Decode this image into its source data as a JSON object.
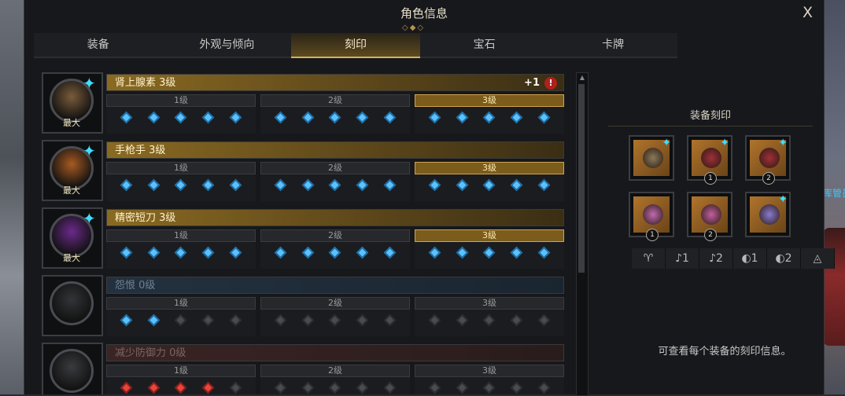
{
  "window": {
    "title": "角色信息",
    "close_label": "X"
  },
  "tabs": [
    {
      "label": "装备",
      "active": false
    },
    {
      "label": "外观与倾向",
      "active": false
    },
    {
      "label": "刻印",
      "active": true
    },
    {
      "label": "宝石",
      "active": false
    },
    {
      "label": "卡牌",
      "active": false
    }
  ],
  "level_labels": [
    "1级",
    "2级",
    "3级"
  ],
  "engravings": [
    {
      "name": "肾上腺素 3级",
      "style": "gold",
      "badge": "最大",
      "plus": "+1",
      "alert": "!",
      "active_level": 3,
      "gems": [
        "blue",
        "blue",
        "blue",
        "blue",
        "blue",
        "blue",
        "blue",
        "blue",
        "blue",
        "blue",
        "blue",
        "blue",
        "blue",
        "blue",
        "blue"
      ],
      "orb_color": "#7a5c3a"
    },
    {
      "name": "手枪手 3级",
      "style": "gold",
      "badge": "最大",
      "plus": "",
      "alert": "",
      "active_level": 3,
      "gems": [
        "blue",
        "blue",
        "blue",
        "blue",
        "blue",
        "blue",
        "blue",
        "blue",
        "blue",
        "blue",
        "blue",
        "blue",
        "blue",
        "blue",
        "blue"
      ],
      "orb_color": "#a85a22"
    },
    {
      "name": "精密短刀 3级",
      "style": "gold",
      "badge": "最大",
      "plus": "",
      "alert": "",
      "active_level": 3,
      "gems": [
        "blue",
        "blue",
        "blue",
        "blue",
        "blue",
        "blue",
        "blue",
        "blue",
        "blue",
        "blue",
        "blue",
        "blue",
        "blue",
        "blue",
        "blue"
      ],
      "orb_color": "#6a2a8a"
    },
    {
      "name": "怨恨 0级",
      "style": "blue",
      "badge": "",
      "plus": "",
      "alert": "",
      "active_level": 0,
      "gems": [
        "blue",
        "blue",
        "off",
        "off",
        "off",
        "off",
        "off",
        "off",
        "off",
        "off",
        "off",
        "off",
        "off",
        "off",
        "off"
      ],
      "orb_color": "#333438"
    },
    {
      "name": "减少防御力 0级",
      "style": "red",
      "badge": "",
      "plus": "",
      "alert": "",
      "active_level": 0,
      "gems": [
        "red",
        "red",
        "red",
        "red",
        "off",
        "off",
        "off",
        "off",
        "off",
        "off",
        "off",
        "off",
        "off",
        "off",
        "off"
      ],
      "orb_color": "#3a3b3f"
    }
  ],
  "side_panel": {
    "title": "装备刻印",
    "slots": [
      {
        "item": "necklace-icon",
        "number": "",
        "has_spark": true,
        "color": "#8a7a5a"
      },
      {
        "item": "earring-icon",
        "number": "1",
        "has_spark": true,
        "color": "#a0303a"
      },
      {
        "item": "earring-icon",
        "number": "2",
        "has_spark": true,
        "color": "#a0303a"
      },
      {
        "item": "ring-icon",
        "number": "1",
        "has_spark": false,
        "color": "#c06ab0"
      },
      {
        "item": "ring-icon",
        "number": "2",
        "has_spark": false,
        "color": "#c060a0"
      },
      {
        "item": "stone-icon",
        "number": "",
        "has_spark": true,
        "color": "#8a7ad0"
      }
    ],
    "filters": [
      "♈",
      "♪1",
      "♪2",
      "◐1",
      "◐2",
      "◬"
    ],
    "hint": "可查看每个装备的刻印信息。"
  },
  "background": {
    "npc_text": "库管员斯克"
  }
}
